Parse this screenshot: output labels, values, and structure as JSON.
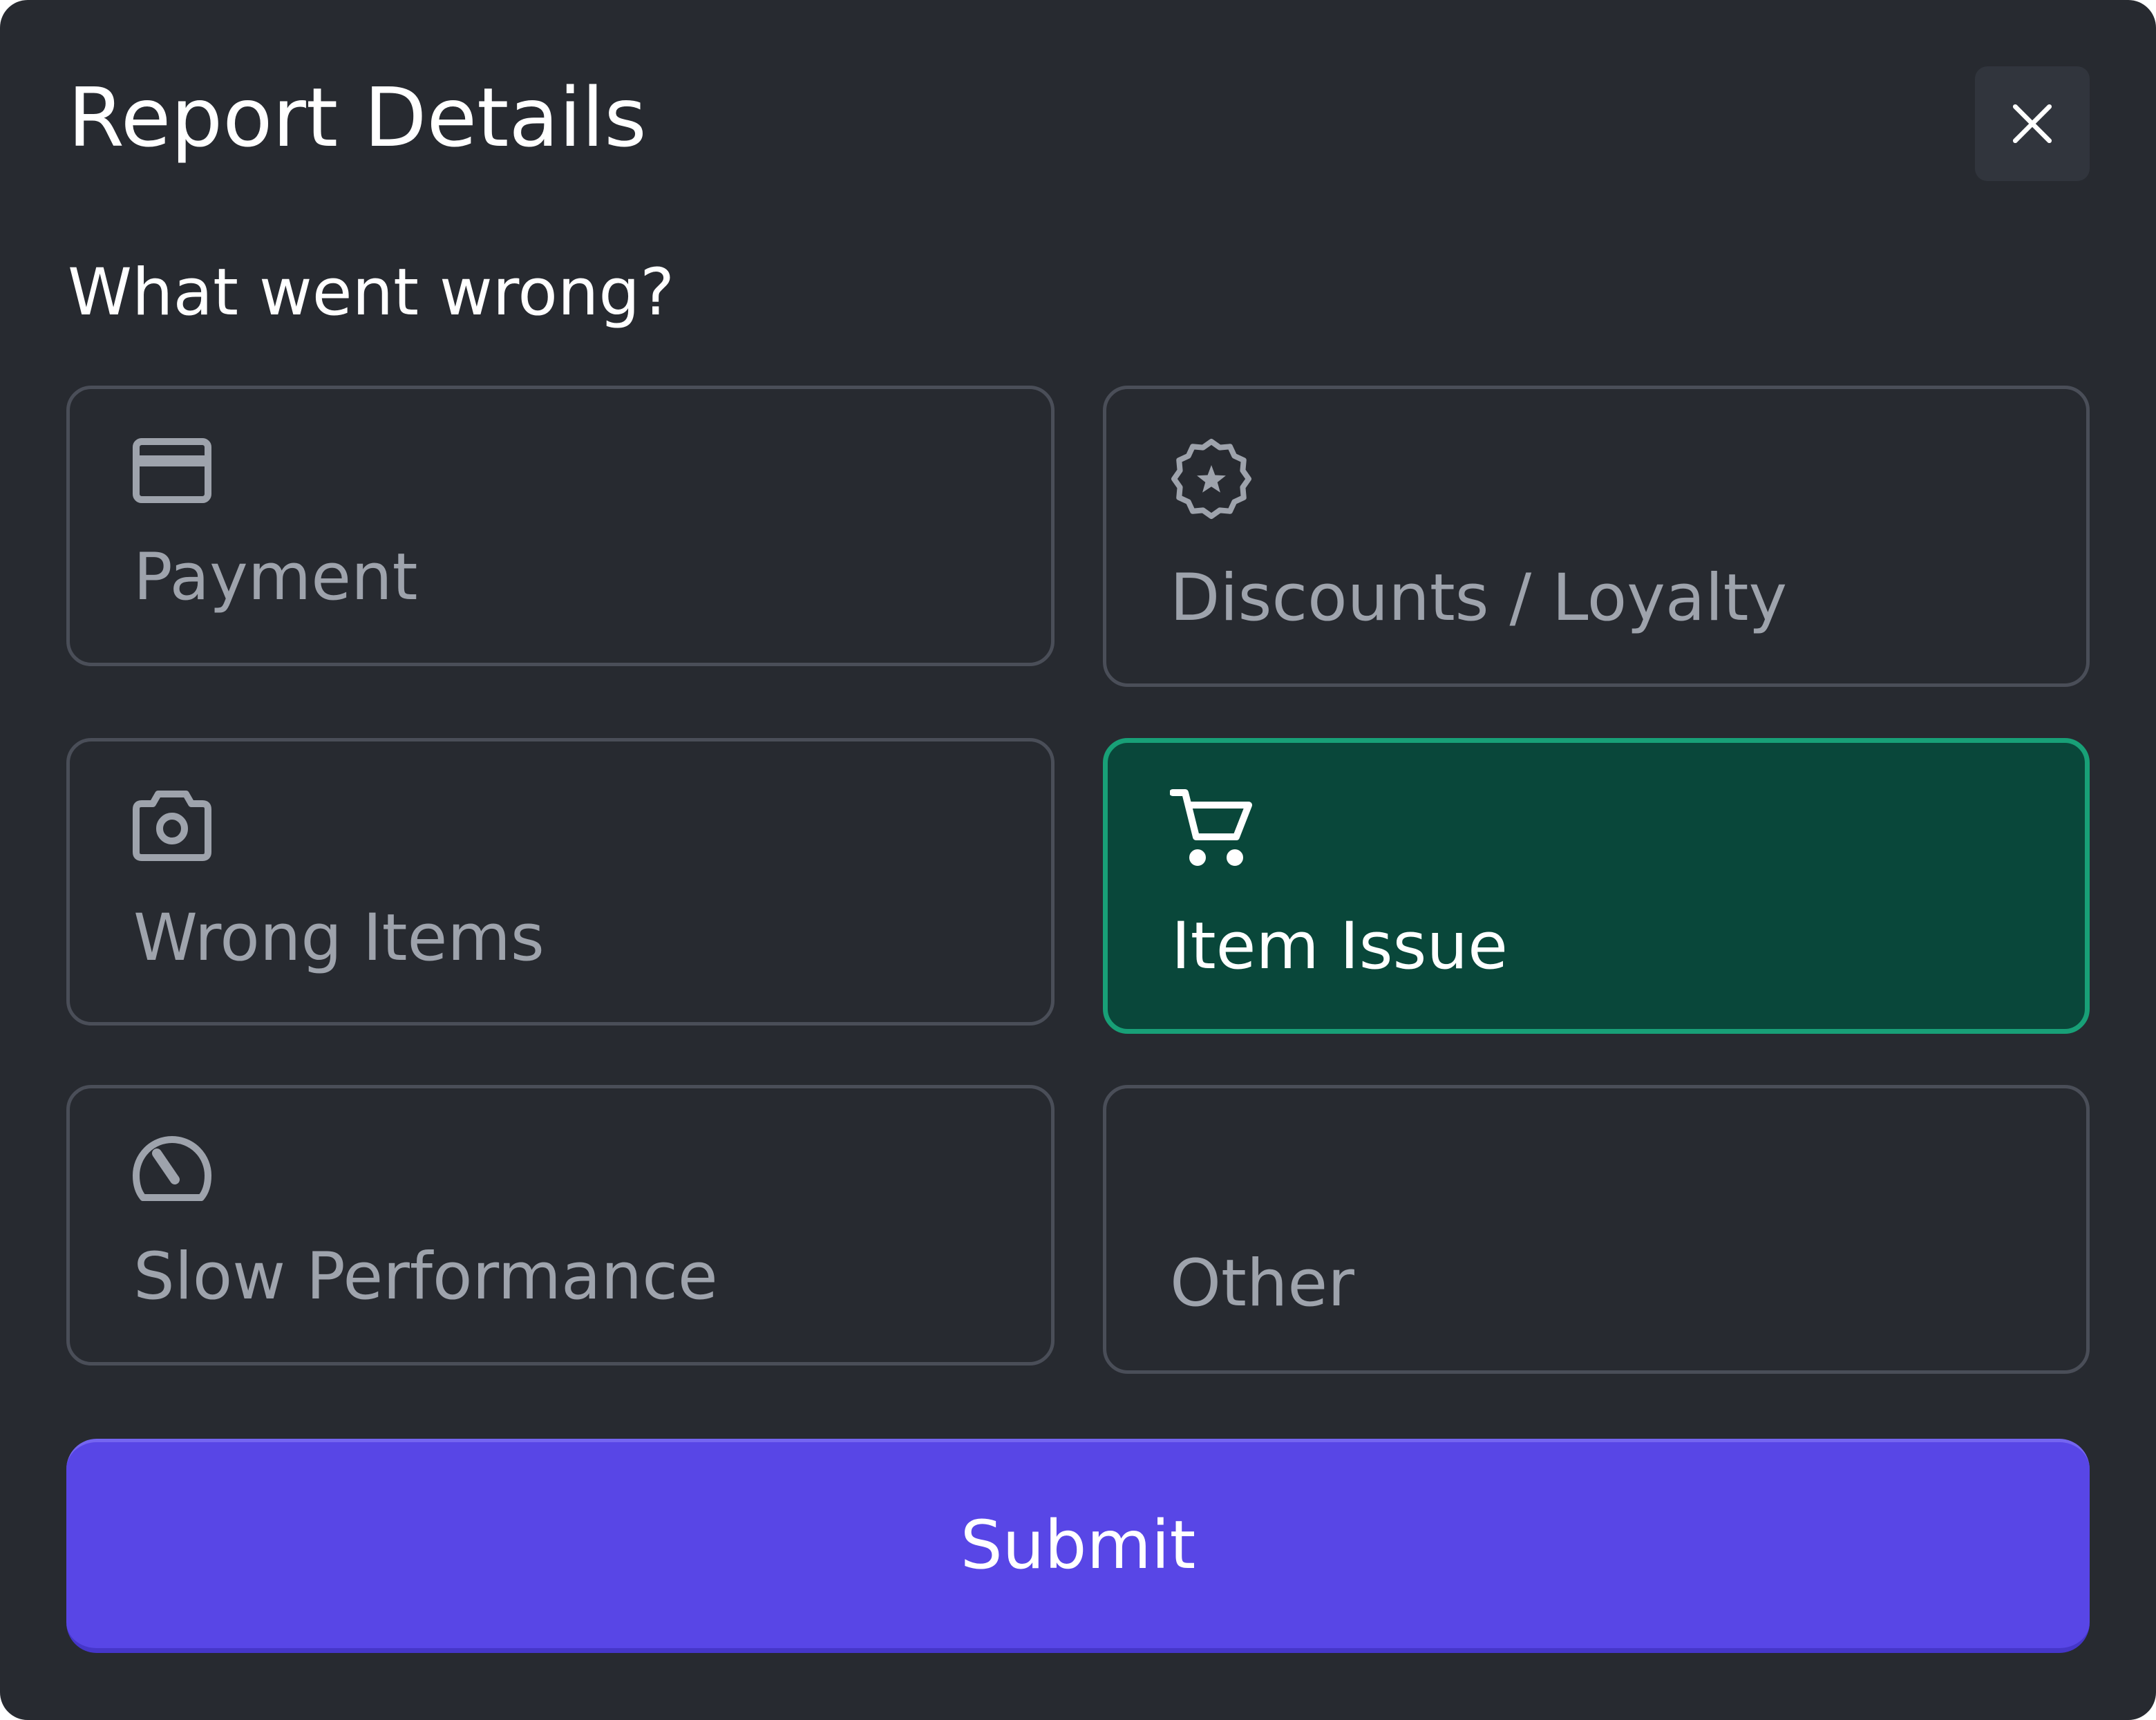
{
  "dialog": {
    "title": "Report Details",
    "close_icon": "close-icon",
    "question": "What went wrong?"
  },
  "options": [
    {
      "label": "Payment",
      "icon": "credit-card-icon",
      "selected": false
    },
    {
      "label": "Discounts / Loyalty",
      "icon": "badge-star-icon",
      "selected": false
    },
    {
      "label": "Wrong Items",
      "icon": "camera-icon",
      "selected": false
    },
    {
      "label": "Item Issue",
      "icon": "shopping-cart-icon",
      "selected": true
    },
    {
      "label": "Slow Performance",
      "icon": "speedometer-icon",
      "selected": false
    },
    {
      "label": "Other",
      "icon": "",
      "selected": false
    }
  ],
  "submit": {
    "label": "Submit"
  },
  "colors": {
    "background": "#272a30",
    "selected_background": "#09473a",
    "selected_border": "#18a077",
    "accent": "#5846e6",
    "muted_text": "#9ea3ac"
  }
}
